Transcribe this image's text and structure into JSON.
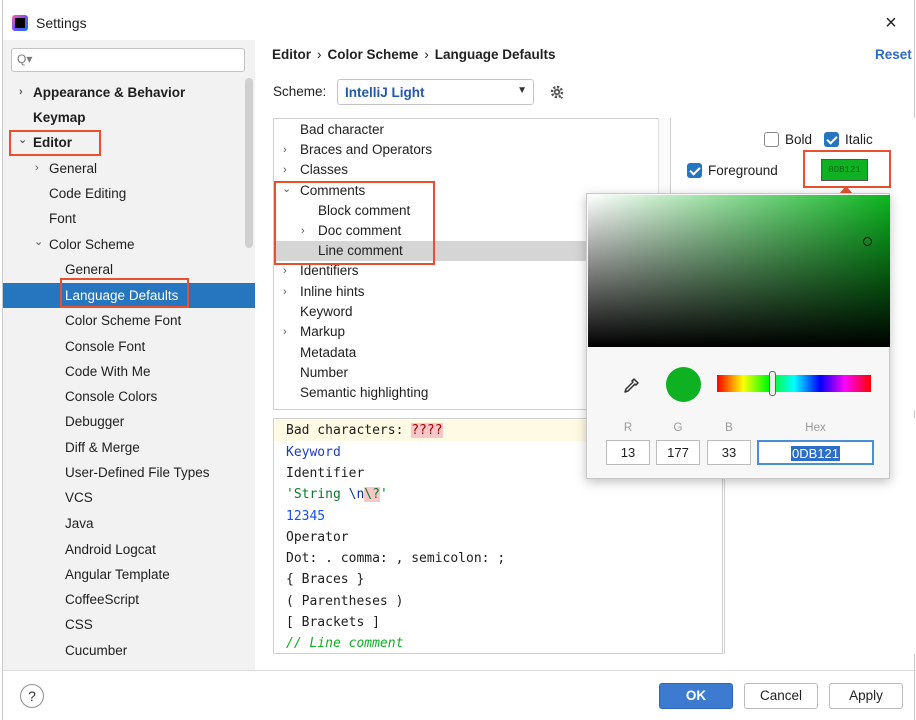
{
  "window": {
    "title": "Settings"
  },
  "search": {
    "placeholder": "Q▾"
  },
  "sidebar": {
    "items": [
      {
        "label": "Appearance & Behavior",
        "arrow": "›"
      },
      {
        "label": "Keymap"
      },
      {
        "label": "Editor",
        "arrow": "⌄"
      },
      {
        "label": "General",
        "arrow": "›"
      },
      {
        "label": "Code Editing"
      },
      {
        "label": "Font"
      },
      {
        "label": "Color Scheme",
        "arrow": "⌄"
      },
      {
        "label": "General"
      },
      {
        "label": "Language Defaults"
      },
      {
        "label": "Color Scheme Font"
      },
      {
        "label": "Console Font"
      },
      {
        "label": "Code With Me"
      },
      {
        "label": "Console Colors"
      },
      {
        "label": "Debugger"
      },
      {
        "label": "Diff & Merge"
      },
      {
        "label": "User-Defined File Types"
      },
      {
        "label": "VCS"
      },
      {
        "label": "Java"
      },
      {
        "label": "Android Logcat"
      },
      {
        "label": "Angular Template"
      },
      {
        "label": "CoffeeScript"
      },
      {
        "label": "CSS"
      },
      {
        "label": "Cucumber"
      }
    ]
  },
  "breadcrumb": {
    "part1": "Editor",
    "part2": "Color Scheme",
    "part3": "Language Defaults",
    "sep": "›"
  },
  "reset_label": "Reset",
  "scheme": {
    "label": "Scheme:",
    "value": "IntelliJ Light"
  },
  "tree": {
    "rows": [
      {
        "label": "Bad character"
      },
      {
        "label": "Braces and Operators",
        "arrow": "›"
      },
      {
        "label": "Classes",
        "arrow": "›"
      },
      {
        "label": "Comments",
        "arrow": "⌄"
      },
      {
        "label": "Block comment"
      },
      {
        "label": "Doc comment",
        "arrow": "›"
      },
      {
        "label": "Line comment"
      },
      {
        "label": "Identifiers",
        "arrow": "›"
      },
      {
        "label": "Inline hints",
        "arrow": "›"
      },
      {
        "label": "Keyword"
      },
      {
        "label": "Markup",
        "arrow": "›"
      },
      {
        "label": "Metadata"
      },
      {
        "label": "Number"
      },
      {
        "label": "Semantic highlighting"
      }
    ]
  },
  "props": {
    "bold": "Bold",
    "italic": "Italic",
    "foreground": "Foreground",
    "swatch_text": "0DB121"
  },
  "picker": {
    "labels": {
      "r": "R",
      "g": "G",
      "b": "B",
      "hex": "Hex"
    },
    "r": "13",
    "g": "177",
    "b": "33",
    "hex": "0DB121",
    "color": "#0DB121"
  },
  "preview": {
    "bad": "Bad characters: ",
    "bad_mark": "????",
    "keyword": "Keyword",
    "identifier": "Identifier",
    "string_a": "'String ",
    "string_esc1": "\\n",
    "string_esc2": "\\?",
    "string_b": "'",
    "number": "12345",
    "operator": "Operator",
    "dot": "Dot: . comma: , semicolon: ;",
    "braces": "{ Braces }",
    "parens": "( Parentheses )",
    "brackets": "[ Brackets ]",
    "line_comment": "// Line comment"
  },
  "buttons": {
    "ok": "OK",
    "cancel": "Cancel",
    "apply": "Apply",
    "help": "?"
  },
  "close_icon": "×",
  "colors": {
    "accent": "#2675BF",
    "highlight_border": "#E8502E"
  }
}
